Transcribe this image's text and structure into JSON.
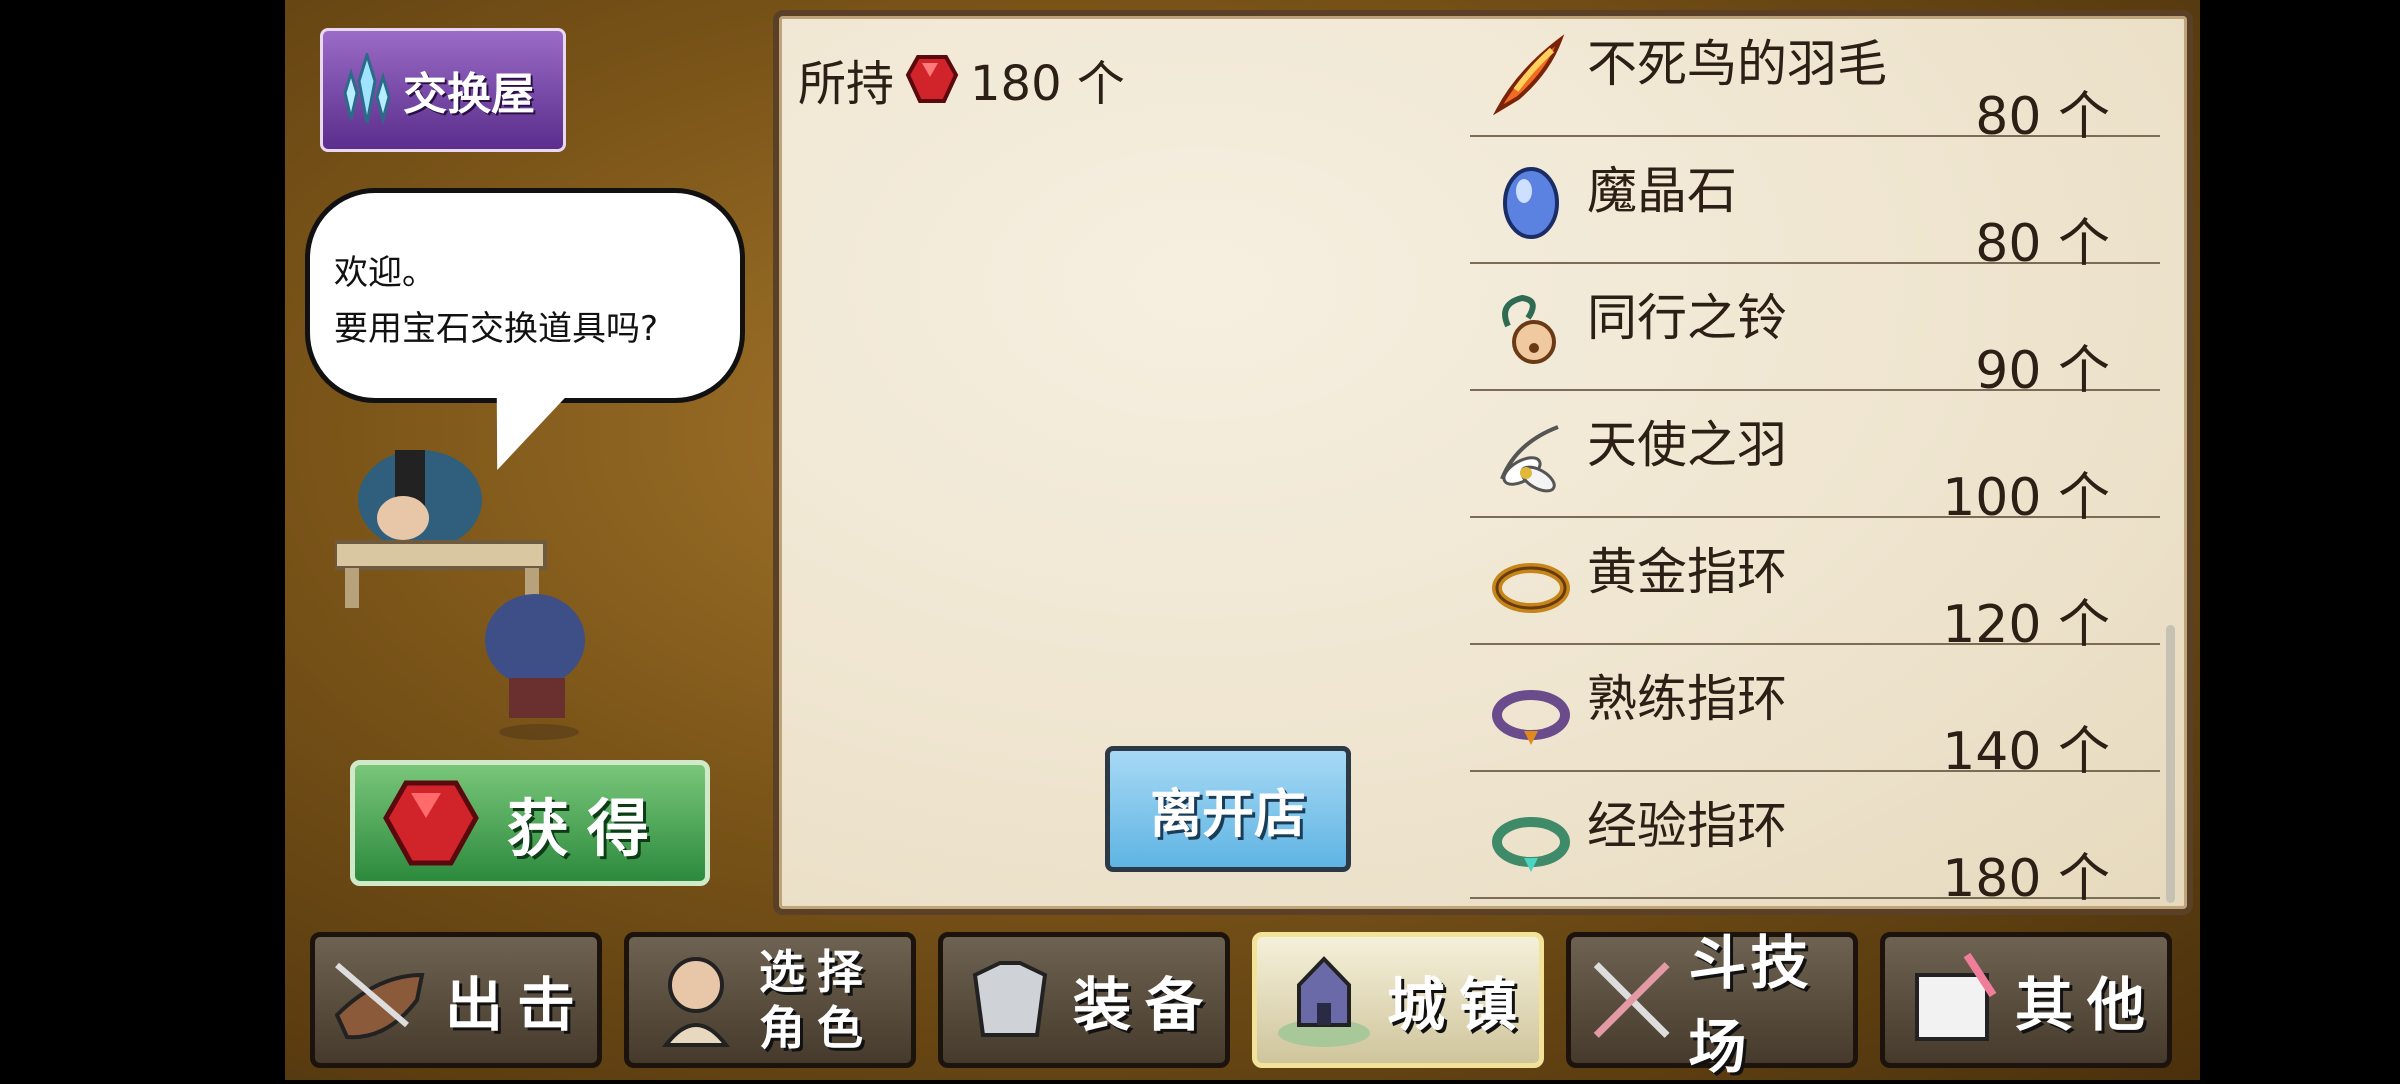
{
  "shop": {
    "title": "交换屋"
  },
  "dialog": {
    "line1": "欢迎。",
    "line2": "要用宝石交换道具吗?"
  },
  "get_button": {
    "label": "获得"
  },
  "owned": {
    "prefix": "所持",
    "amount": "180 个"
  },
  "items": [
    {
      "name": "不死鸟的羽毛",
      "price": "80 个",
      "icon": "phoenix-feather-icon"
    },
    {
      "name": "魔晶石",
      "price": "80 个",
      "icon": "magic-crystal-icon"
    },
    {
      "name": "同行之铃",
      "price": "90 个",
      "icon": "bell-icon"
    },
    {
      "name": "天使之羽",
      "price": "100 个",
      "icon": "angel-feather-icon"
    },
    {
      "name": "黄金指环",
      "price": "120 个",
      "icon": "gold-ring-icon"
    },
    {
      "name": "熟练指环",
      "price": "140 个",
      "icon": "skill-ring-icon"
    },
    {
      "name": "经验指环",
      "price": "180 个",
      "icon": "exp-ring-icon"
    }
  ],
  "leave_button": {
    "label": "离开店"
  },
  "nav": [
    {
      "label": "出击",
      "icon": "sortie-icon"
    },
    {
      "label": "选择角色",
      "line1": "选择",
      "line2": "角色",
      "icon": "character-icon"
    },
    {
      "label": "装备",
      "icon": "armor-icon"
    },
    {
      "label": "城镇",
      "icon": "town-icon",
      "active": true
    },
    {
      "label": "斗技场",
      "icon": "arena-icon"
    },
    {
      "label": "其他",
      "icon": "other-icon"
    }
  ]
}
